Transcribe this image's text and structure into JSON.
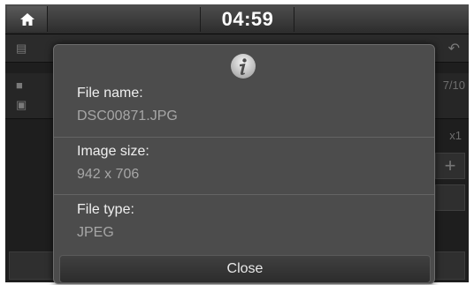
{
  "status_bar": {
    "time": "04:59",
    "home_icon": "home-icon"
  },
  "background": {
    "counter": "7/10",
    "zoom": "x1",
    "zoom_in_symbol": "+"
  },
  "dialog": {
    "icon": "info-icon",
    "fields": [
      {
        "label": "File name:",
        "value": "DSC00871.JPG"
      },
      {
        "label": "Image size:",
        "value": "942 x 706"
      },
      {
        "label": "File type:",
        "value": "JPEG"
      }
    ],
    "close_label": "Close"
  },
  "colors": {
    "dialog_bg": "#4c4c4c",
    "label": "#efefef",
    "value": "#a6a6a6",
    "screen_bg": "#151515"
  }
}
